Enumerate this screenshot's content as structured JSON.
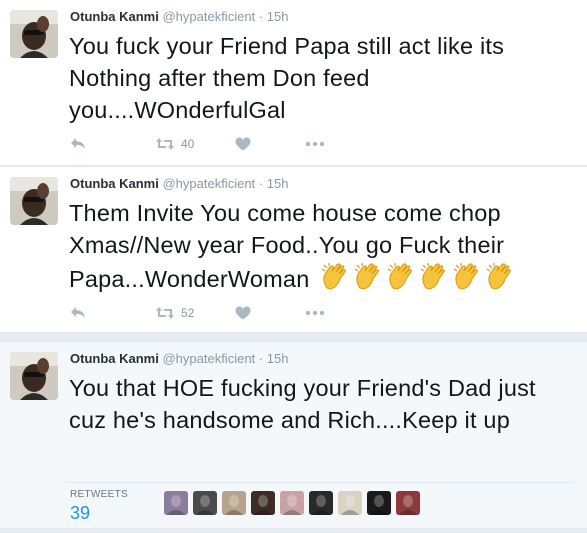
{
  "tweets": [
    {
      "author": {
        "name": "Otunba Kanmi",
        "handle": "@hypatekficient"
      },
      "separator": "·",
      "time": "15h",
      "text": "You fuck your Friend Papa still act like its Nothing after them Don feed you....WOnderfulGal",
      "retweet_count": "40",
      "icons": {
        "reply": "reply-icon",
        "retweet": "retweet-icon",
        "like": "heart-icon",
        "more": "more-icon"
      }
    },
    {
      "author": {
        "name": "Otunba Kanmi",
        "handle": "@hypatekficient"
      },
      "separator": "·",
      "time": "15h",
      "text": "Them Invite You come house come chop Xmas//New year Food..You go Fuck their Papa...WonderWoman",
      "emoji": "clapping-hands-icon",
      "emoji_count": 6,
      "retweet_count": "52",
      "icons": {
        "reply": "reply-icon",
        "retweet": "retweet-icon",
        "like": "heart-icon",
        "more": "more-icon"
      }
    },
    {
      "author": {
        "name": "Otunba Kanmi",
        "handle": "@hypatekficient"
      },
      "separator": "·",
      "time": "15h",
      "text": "You that HOE fucking your Friend's Dad just cuz he's handsome and Rich....Keep it up",
      "stats": {
        "label": "RETWEETS",
        "value": "39"
      },
      "retweeter_avatars": 9
    }
  ],
  "colors": {
    "background": "#e6ecf0",
    "accent": "#1b95e0",
    "muted": "#8899a6",
    "icon": "#aab8c2",
    "emoji": "#f7c23c"
  }
}
